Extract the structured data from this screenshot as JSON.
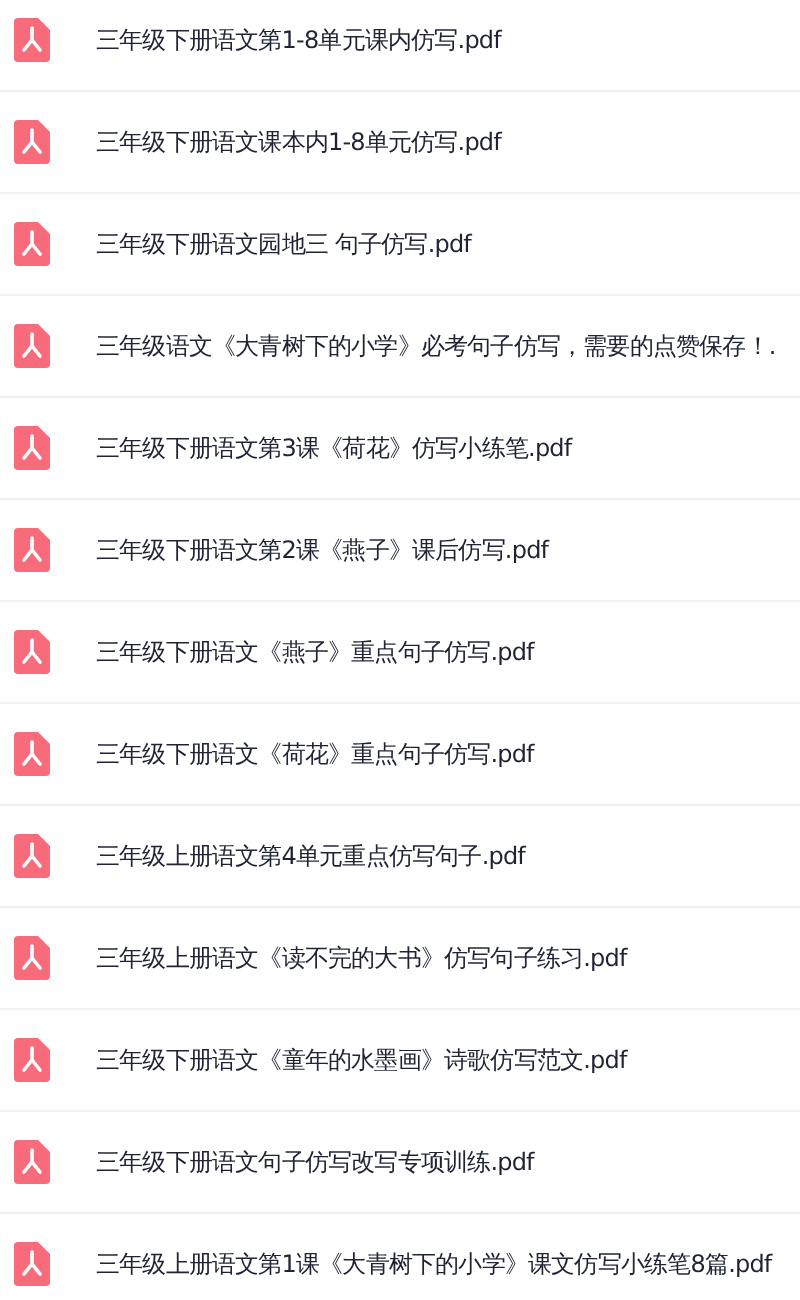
{
  "files": [
    {
      "name": "三年级下册语文第1-8单元课内仿写.pdf",
      "kind": "pdf"
    },
    {
      "name": "三年级下册语文课本内1-8单元仿写.pdf",
      "kind": "pdf"
    },
    {
      "name": "三年级下册语文园地三 句子仿写.pdf",
      "kind": "pdf"
    },
    {
      "name": "三年级语文《大青树下的小学》必考句子仿写，需要的点赞保存！.",
      "kind": "pdf"
    },
    {
      "name": "三年级下册语文第3课《荷花》仿写小练笔.pdf",
      "kind": "pdf"
    },
    {
      "name": "三年级下册语文第2课《燕子》课后仿写.pdf",
      "kind": "pdf"
    },
    {
      "name": "三年级下册语文《燕子》重点句子仿写.pdf",
      "kind": "pdf"
    },
    {
      "name": "三年级下册语文《荷花》重点句子仿写.pdf",
      "kind": "pdf"
    },
    {
      "name": "三年级上册语文第4单元重点仿写句子.pdf",
      "kind": "pdf"
    },
    {
      "name": "三年级上册语文《读不完的大书》仿写句子练习.pdf",
      "kind": "pdf"
    },
    {
      "name": "三年级下册语文《童年的水墨画》诗歌仿写范文.pdf",
      "kind": "pdf"
    },
    {
      "name": "三年级下册语文句子仿写改写专项训练.pdf",
      "kind": "pdf"
    },
    {
      "name": "三年级上册语文第1课《大青树下的小学》课文仿写小练笔8篇.pdf",
      "kind": "pdf"
    }
  ]
}
